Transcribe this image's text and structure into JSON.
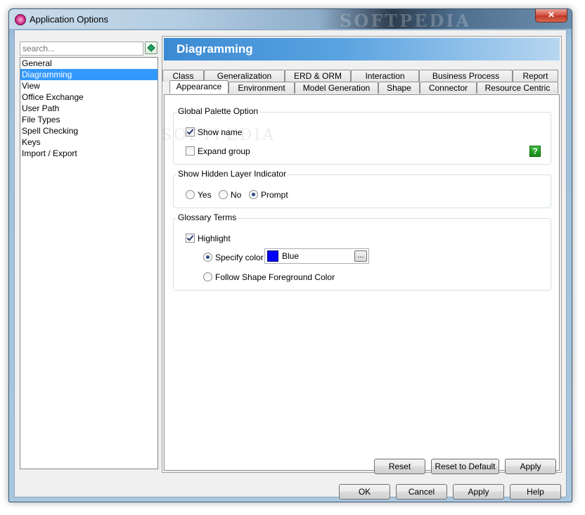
{
  "window": {
    "title": "Application Options",
    "watermark": "SOFTPEDIA",
    "close_label": "✕"
  },
  "search": {
    "placeholder": "search..."
  },
  "nav": {
    "items": [
      {
        "label": "General"
      },
      {
        "label": "Diagramming",
        "selected": true
      },
      {
        "label": "View"
      },
      {
        "label": "Office Exchange"
      },
      {
        "label": "User Path"
      },
      {
        "label": "File Types"
      },
      {
        "label": "Spell Checking"
      },
      {
        "label": "Keys"
      },
      {
        "label": "Import / Export"
      }
    ]
  },
  "panel": {
    "title": "Diagramming"
  },
  "tabs": {
    "row1": [
      "Class",
      "Generalization",
      "ERD & ORM",
      "Interaction",
      "Business Process",
      "Report"
    ],
    "row2": [
      "Appearance",
      "Environment",
      "Model Generation",
      "Shape",
      "Connector",
      "Resource Centric"
    ],
    "active": "Appearance"
  },
  "global_palette": {
    "title": "Global Palette Option",
    "show_name": {
      "label": "Show name",
      "checked": true
    },
    "expand_group": {
      "label": "Expand group",
      "checked": false
    },
    "help_label": "?"
  },
  "hidden_layer": {
    "title": "Show Hidden Layer Indicator",
    "options": [
      "Yes",
      "No",
      "Prompt"
    ],
    "selected": "Prompt"
  },
  "glossary": {
    "title": "Glossary Terms",
    "highlight": {
      "label": "Highlight",
      "checked": true
    },
    "specify_color": {
      "label": "Specify color",
      "selected": true
    },
    "color": {
      "name": "Blue",
      "hex": "#0000ff",
      "browse_label": "..."
    },
    "follow_shape": {
      "label": "Follow Shape Foreground Color",
      "selected": false
    }
  },
  "panel_buttons": {
    "reset": "Reset",
    "reset_default": "Reset to Default",
    "apply": "Apply"
  },
  "dialog_buttons": {
    "ok": "OK",
    "cancel": "Cancel",
    "apply": "Apply",
    "help": "Help"
  }
}
